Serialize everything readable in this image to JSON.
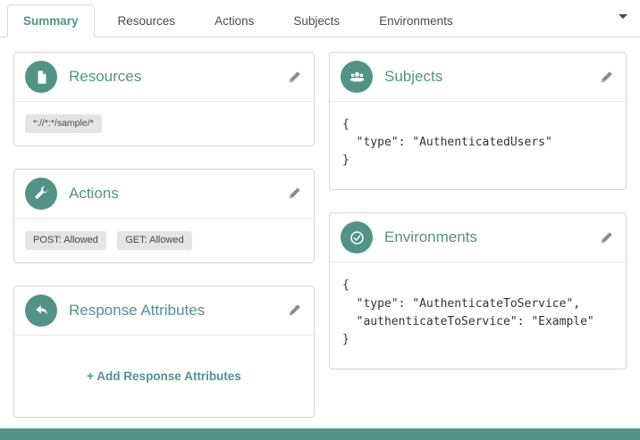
{
  "colors": {
    "accent": "#519387",
    "pill_background": "#e4e4e4",
    "footer_bar": "#519387"
  },
  "tabs": {
    "items": [
      {
        "label": "Summary",
        "active": true
      },
      {
        "label": "Resources",
        "active": false
      },
      {
        "label": "Actions",
        "active": false
      },
      {
        "label": "Subjects",
        "active": false
      },
      {
        "label": "Environments",
        "active": false
      }
    ],
    "overflow_caret_icon": "chevron-down-icon"
  },
  "cards": {
    "resources": {
      "title": "Resources",
      "icon": "file-icon",
      "values": [
        "*://*:*/sample/*"
      ]
    },
    "actions": {
      "title": "Actions",
      "icon": "wrench-icon",
      "values": [
        "POST: Allowed",
        "GET: Allowed"
      ]
    },
    "response_attributes": {
      "title": "Response Attributes",
      "icon": "reply-arrow-icon",
      "add_label": "+ Add Response Attributes"
    },
    "subjects": {
      "title": "Subjects",
      "icon": "users-icon",
      "code": "{\n  \"type\": \"AuthenticatedUsers\"\n}"
    },
    "environments": {
      "title": "Environments",
      "icon": "check-circle-icon",
      "code": "{\n  \"type\": \"AuthenticateToService\",\n  \"authenticateToService\": \"Example\"\n}"
    }
  }
}
